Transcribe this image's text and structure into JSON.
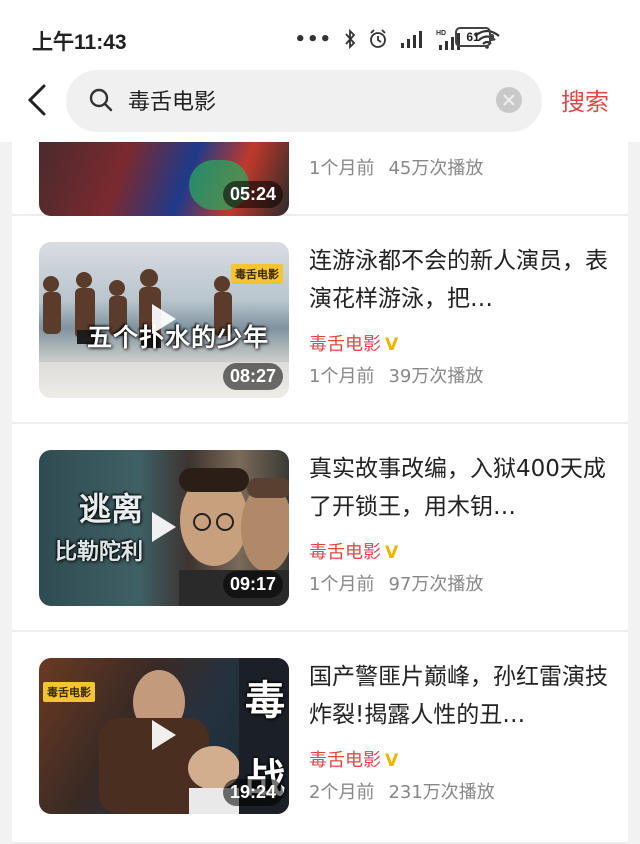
{
  "status_bar": {
    "time": "上午11:43",
    "battery": "61",
    "icons": [
      "more-dots-icon",
      "bluetooth-icon",
      "alarm-icon",
      "signal-icon",
      "hd-signal-icon",
      "wifi-icon",
      "battery-icon"
    ]
  },
  "search": {
    "query": "毒舌电影",
    "button_label": "搜索"
  },
  "colors": {
    "accent": "#e04848",
    "verified": "#f0b400",
    "meta": "#888888"
  },
  "videos": [
    {
      "duration": "05:24",
      "age": "1个月前",
      "views": "45万次播放"
    },
    {
      "title": "连游泳都不会的新人演员，表演花样游泳，把…",
      "channel": "毒舌电影",
      "verified": "V",
      "duration": "08:27",
      "age": "1个月前",
      "views": "39万次播放",
      "thumb_text": "五个扑水的少年",
      "thumb_tag": "毒舌电影"
    },
    {
      "title": "真实故事改编，入狱400天成了开锁王，用木钥…",
      "channel": "毒舌电影",
      "verified": "V",
      "duration": "09:17",
      "age": "1个月前",
      "views": "97万次播放",
      "thumb_text_1": "逃离",
      "thumb_text_2": "比勒陀利"
    },
    {
      "title": "国产警匪片巅峰，孙红雷演技炸裂!揭露人性的丑…",
      "channel": "毒舌电影",
      "verified": "V",
      "duration": "19:24",
      "age": "2个月前",
      "views": "231万次播放",
      "thumb_text_1": "毒",
      "thumb_text_2": "战",
      "thumb_tag": "毒舌电影"
    }
  ]
}
